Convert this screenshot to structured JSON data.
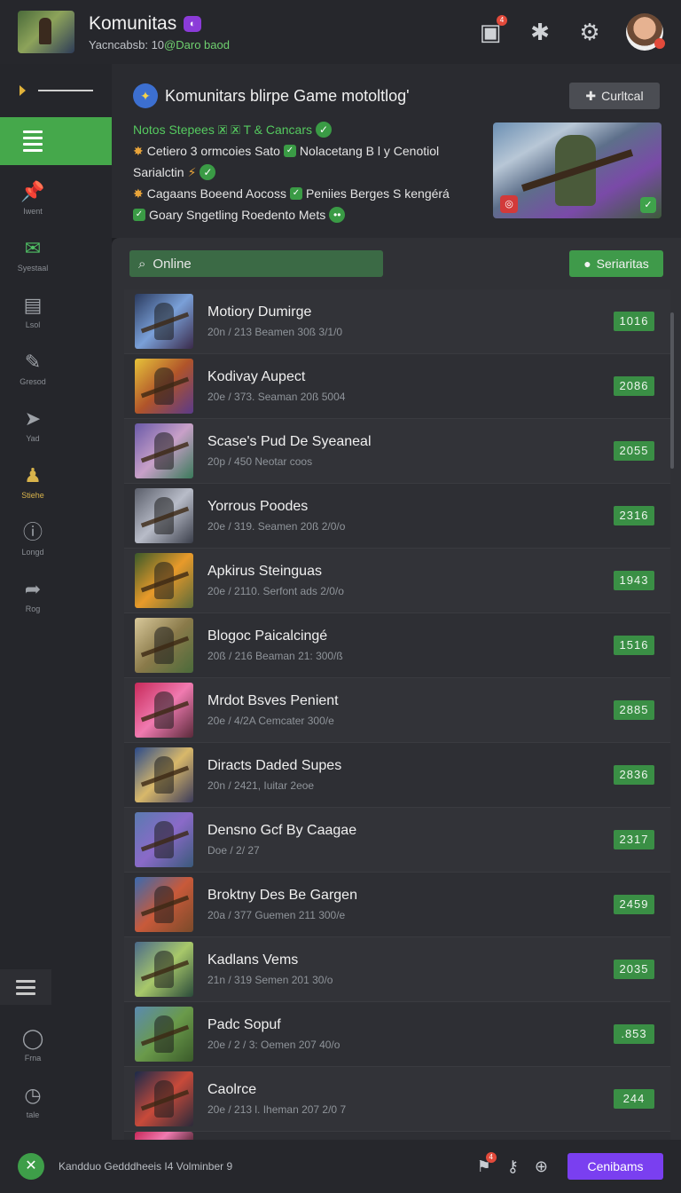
{
  "header": {
    "title": "Komunitas",
    "subtitle_prefix": "Yacncabsb: 10",
    "subtitle_highlight": "@Daro baod",
    "icons": [
      "gift-icon",
      "puzzle-icon",
      "gear-icon"
    ],
    "gift_badge": "4"
  },
  "sidebar": {
    "items": [
      {
        "icon": "pin-icon",
        "glyph": "📌",
        "label": "Iwent"
      },
      {
        "icon": "inbox-icon",
        "glyph": "✉",
        "label": "Syestaal"
      },
      {
        "icon": "panel-icon",
        "glyph": "▤",
        "label": "Lsol"
      },
      {
        "icon": "wrench-icon",
        "glyph": "✎",
        "label": "Gresod"
      },
      {
        "icon": "send-icon",
        "glyph": "➤",
        "label": "Yad"
      },
      {
        "icon": "user-icon",
        "glyph": "♟",
        "label": "Stiehe"
      },
      {
        "icon": "info-icon",
        "glyph": "ⓘ",
        "label": "Longd"
      },
      {
        "icon": "share-icon",
        "glyph": "➦",
        "label": "Rog"
      }
    ],
    "bottom": [
      {
        "icon": "circle-icon",
        "glyph": "◯",
        "label": "Frna"
      },
      {
        "icon": "clock-icon",
        "glyph": "◷",
        "label": "tale"
      }
    ]
  },
  "hero": {
    "title": "Komunitars blirpe Game motoltlog'",
    "button_label": "Curltcal",
    "line1": "Notos Stepees 🗷 🗷 T & Cancars",
    "line2a": "Cetiero 3 ormcoies Sato",
    "line2b": "Nolacetang B l y Cenotiol",
    "line3": "Sarialctin",
    "line4a": "Cagaans Boeend Aocoss",
    "line4b": "Peniies Berges S kengérá",
    "line5": "Goary Sngetling Roedento Mets"
  },
  "search": {
    "value": "Online"
  },
  "filter_button": "Seriaritas",
  "games": [
    {
      "title": "Motiory Dumirge",
      "sub": "20n / 213 Beamen 30ß 3/1/0",
      "score": "1016"
    },
    {
      "title": "Kodivay Aupect",
      "sub": "20e / 373. Seaman 20ß 5004",
      "score": "2086"
    },
    {
      "title": "Scase's Pud De Syeaneal",
      "sub": "20p / 450 Neotar coos",
      "score": "2055"
    },
    {
      "title": "Yorrous Poodes",
      "sub": "20e / 319. Seamen 20ß 2/0/o",
      "score": "2316"
    },
    {
      "title": "Apkirus Steinguas",
      "sub": "20e / 2110. Serfont ads 2/0/o",
      "score": "1943"
    },
    {
      "title": "Blogoc Paicalcingé",
      "sub": "20ß / 216 Beaman 21: 300/ß",
      "score": "1516"
    },
    {
      "title": "Mrdot Bsves Penient",
      "sub": "20e / 4/2A Cemcater 300/e",
      "score": "2885"
    },
    {
      "title": "Diracts Daded Supes",
      "sub": "20n / 2421, Iuitar 2eoe",
      "score": "2836"
    },
    {
      "title": "Densno Gcf By Caagae",
      "sub": "Doe / 2/ 27",
      "score": "2317"
    },
    {
      "title": "Broktny Des Be Gargen",
      "sub": "20a / 377 Guemen 211 300/e",
      "score": "2459"
    },
    {
      "title": "Kadlans Vems",
      "sub": "21n / 319 Semen 201 30/o",
      "score": "2035"
    },
    {
      "title": "Padc Sopuf",
      "sub": "20e / 2 / 3: Oemen 207 40/o",
      "score": ".853"
    },
    {
      "title": "Caolrce",
      "sub": "20e / 213 l. Iheman 207 2/0 7",
      "score": "244"
    }
  ],
  "bottom_bar": {
    "text": "Kandduo Gedddheeis I4 Volminber 9",
    "button": "Cenibams",
    "notif": "4"
  },
  "colors": {
    "accent_green": "#45a84b",
    "accent_purple": "#7a3ff0",
    "background": "#1e1f23"
  }
}
